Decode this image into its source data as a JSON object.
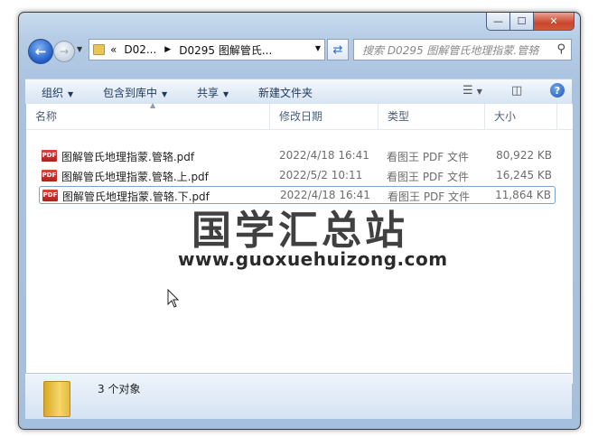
{
  "window": {
    "min_label": "—",
    "max_label": "☐",
    "close_label": "✕"
  },
  "nav": {
    "back_icon": "back-arrow-icon",
    "forward_icon": "forward-arrow-icon",
    "breadcrumb": {
      "overflow": "«",
      "root": "D02...",
      "current": "D0295 图解管氏..."
    },
    "search_placeholder": "搜索 D0295 图解管氏地理指蒙.管辂"
  },
  "toolbar": {
    "organize": "组织",
    "include_library": "包含到库中",
    "share": "共享",
    "new_folder": "新建文件夹"
  },
  "columns": {
    "name": "名称",
    "date": "修改日期",
    "type": "类型",
    "size": "大小"
  },
  "files": [
    {
      "name": "图解管氏地理指蒙.管辂.pdf",
      "date": "2022/4/18 16:41",
      "type": "看图王 PDF 文件",
      "size": "80,922 KB"
    },
    {
      "name": "图解管氏地理指蒙.管辂.上.pdf",
      "date": "2022/5/2 10:11",
      "type": "看图王 PDF 文件",
      "size": "16,245 KB"
    },
    {
      "name": "图解管氏地理指蒙.管辂.下.pdf",
      "date": "2022/4/18 16:41",
      "type": "看图王 PDF 文件",
      "size": "11,864 KB"
    }
  ],
  "pdf_badge": "PDF",
  "watermark": {
    "title": "国学汇总站",
    "url": "www.guoxuehuizong.com"
  },
  "status": {
    "count": "3 个对象"
  },
  "colors": {
    "selection_border": "#7da2ce",
    "pdf_red": "#c0322a"
  }
}
